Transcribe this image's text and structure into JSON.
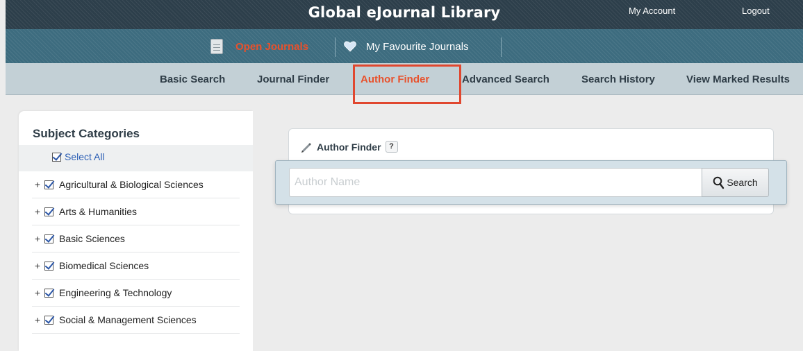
{
  "header": {
    "title": "Global eJournal Library",
    "my_account": "My Account",
    "logout": "Logout"
  },
  "journal_tabs": [
    {
      "label": "Open Journals",
      "icon": "document-icon",
      "active": true
    },
    {
      "label": "My Favourite Journals",
      "icon": "heart-icon",
      "active": false
    }
  ],
  "search_nav": [
    {
      "label": "Basic Search",
      "active": false
    },
    {
      "label": "Journal Finder",
      "active": false
    },
    {
      "label": "Author Finder",
      "active": true
    },
    {
      "label": "Advanced Search",
      "active": false
    },
    {
      "label": "Search History",
      "active": false
    },
    {
      "label": "View Marked Results",
      "active": false
    }
  ],
  "sidebar": {
    "title": "Subject Categories",
    "select_all": "Select All",
    "categories": [
      {
        "label": "Agricultural & Biological Sciences",
        "checked": true
      },
      {
        "label": "Arts & Humanities",
        "checked": true
      },
      {
        "label": "Basic Sciences",
        "checked": true
      },
      {
        "label": "Biomedical Sciences",
        "checked": true
      },
      {
        "label": "Engineering & Technology",
        "checked": true
      },
      {
        "label": "Social & Management Sciences",
        "checked": true
      }
    ],
    "expand_symbol": "+"
  },
  "author_finder": {
    "title": "Author Finder",
    "help": "?",
    "input_placeholder": "Author Name",
    "input_value": "",
    "search_label": "Search"
  },
  "colors": {
    "accent": "#e8512c",
    "header_bg": "#2d3f4b",
    "journals_bar_bg": "#3d6c7f",
    "nav_bg": "#c3d0d6",
    "highlight_box": "#e0472f",
    "link_blue": "#2c5fb5"
  }
}
